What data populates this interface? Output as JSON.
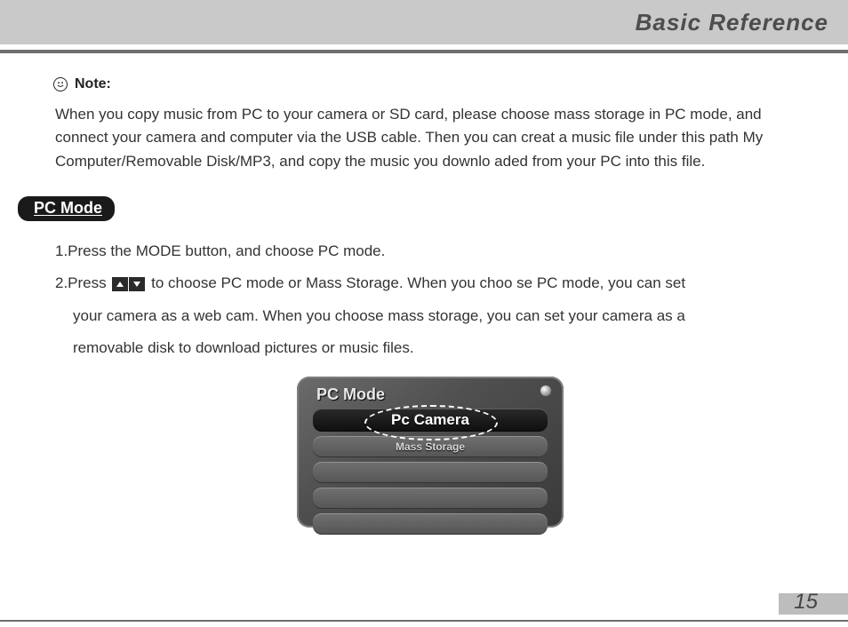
{
  "header": {
    "title": "Basic Reference"
  },
  "note": {
    "label": "Note:",
    "body": "When you copy music from PC to your camera or SD card, please choose mass storage in PC mode, and connect your camera and computer via the USB cable. Then you can creat a music file under this path My Computer/Removable Disk/MP3, and copy the music you downlo aded from your PC into this file."
  },
  "section": {
    "title": "PC  Mode"
  },
  "steps": {
    "s1": "1.Press the MODE button, and choose PC mode.",
    "s2a": "2.Press ",
    "s2b": " to choose PC mode or Mass Storage. When you choo se PC mode, you can set",
    "s2c": "your camera as a web cam. When you choose mass storage, you can set your camera as a",
    "s2d": "removable disk to download pictures or music files."
  },
  "screen": {
    "title": "PC Mode",
    "items": [
      "Pc Camera",
      "Mass Storage",
      "",
      "",
      ""
    ],
    "selected_index": 0
  },
  "page_number": "15"
}
